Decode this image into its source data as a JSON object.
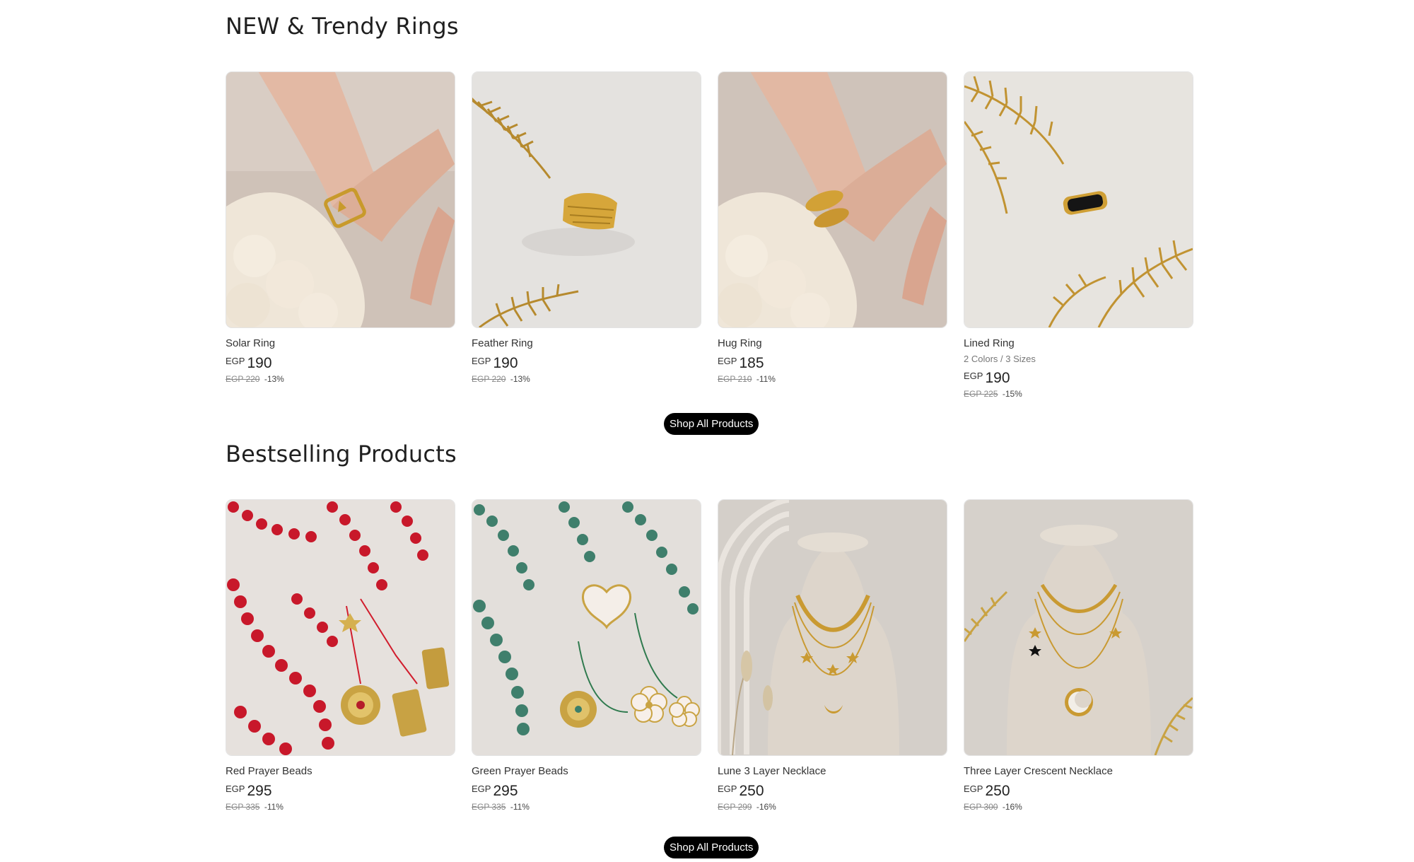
{
  "sections": [
    {
      "title": "NEW & Trendy Rings",
      "products": [
        {
          "name": "Solar Ring",
          "variant": "",
          "currency": "EGP",
          "price": "190",
          "compare_at": "EGP 220",
          "discount": "-13%",
          "image": "gold-star-ring-on-hand"
        },
        {
          "name": "Feather Ring",
          "variant": "",
          "currency": "EGP",
          "price": "190",
          "compare_at": "EGP 220",
          "discount": "-13%",
          "image": "gold-feather-ring-with-leaves"
        },
        {
          "name": "Hug Ring",
          "variant": "",
          "currency": "EGP",
          "price": "185",
          "compare_at": "EGP 210",
          "discount": "-11%",
          "image": "gold-hug-ring-on-hand"
        },
        {
          "name": "Lined Ring",
          "variant": "2 Colors / 3 Sizes",
          "currency": "EGP",
          "price": "190",
          "compare_at": "EGP 225",
          "discount": "-15%",
          "image": "gold-black-lined-ring-with-leaves"
        }
      ],
      "button_label": "Shop All Products"
    },
    {
      "title": "Bestselling Products",
      "products": [
        {
          "name": "Red Prayer Beads",
          "variant": "",
          "currency": "EGP",
          "price": "295",
          "compare_at": "EGP 335",
          "discount": "-11%",
          "image": "red-prayer-beads"
        },
        {
          "name": "Green Prayer Beads",
          "variant": "",
          "currency": "EGP",
          "price": "295",
          "compare_at": "EGP 335",
          "discount": "-11%",
          "image": "green-prayer-beads"
        },
        {
          "name": "Lune 3 Layer Necklace",
          "variant": "",
          "currency": "EGP",
          "price": "250",
          "compare_at": "EGP 299",
          "discount": "-16%",
          "image": "layered-necklace-on-bust"
        },
        {
          "name": "Three Layer Crescent Necklace",
          "variant": "",
          "currency": "EGP",
          "price": "250",
          "compare_at": "EGP 300",
          "discount": "-16%",
          "image": "crescent-necklace-on-bust"
        }
      ],
      "button_label": "Shop All Products"
    }
  ]
}
